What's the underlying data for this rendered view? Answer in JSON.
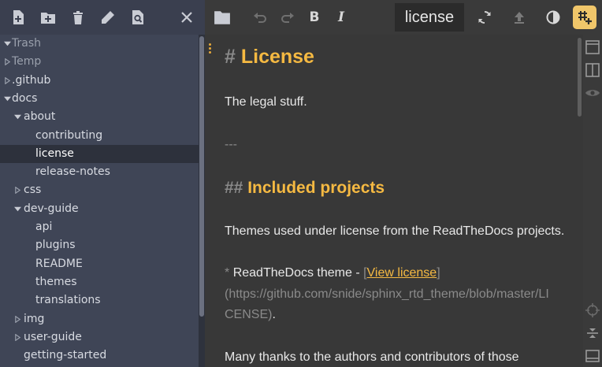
{
  "sidebar": {
    "toolbar": [
      {
        "icon": "new-file-icon"
      },
      {
        "icon": "new-folder-icon"
      },
      {
        "icon": "trash-icon"
      },
      {
        "icon": "pencil-icon"
      },
      {
        "icon": "search-file-icon"
      },
      {
        "icon": "close-icon"
      }
    ],
    "tree": [
      {
        "label": "Trash",
        "depth": 0,
        "caret": "open",
        "dim": true
      },
      {
        "label": "Temp",
        "depth": 0,
        "caret": "closed",
        "dim": true
      },
      {
        "label": ".github",
        "depth": 0,
        "caret": "closed"
      },
      {
        "label": "docs",
        "depth": 0,
        "caret": "open"
      },
      {
        "label": "about",
        "depth": 1,
        "caret": "open"
      },
      {
        "label": "contributing",
        "depth": 2,
        "caret": "none"
      },
      {
        "label": "license",
        "depth": 2,
        "caret": "none",
        "selected": true
      },
      {
        "label": "release-notes",
        "depth": 2,
        "caret": "none"
      },
      {
        "label": "css",
        "depth": 1,
        "caret": "closed"
      },
      {
        "label": "dev-guide",
        "depth": 1,
        "caret": "open"
      },
      {
        "label": "api",
        "depth": 2,
        "caret": "none"
      },
      {
        "label": "plugins",
        "depth": 2,
        "caret": "none"
      },
      {
        "label": "README",
        "depth": 2,
        "caret": "none"
      },
      {
        "label": "themes",
        "depth": 2,
        "caret": "none"
      },
      {
        "label": "translations",
        "depth": 2,
        "caret": "none"
      },
      {
        "label": "img",
        "depth": 1,
        "caret": "closed"
      },
      {
        "label": "user-guide",
        "depth": 1,
        "caret": "closed"
      },
      {
        "label": "getting-started",
        "depth": 1,
        "caret": "none"
      }
    ]
  },
  "editor_toolbar": {
    "title": "license",
    "bold_label": "B",
    "italic_label": "I"
  },
  "document": {
    "h1_marker": "#",
    "h1_text": "License",
    "intro": "The legal stuff.",
    "hr": "---",
    "h2_marker": "##",
    "h2_text": "Included projects",
    "para1": "Themes used under license from the ReadTheDocs projects.",
    "bullet_marker": "*",
    "bullet_text": "ReadTheDocs theme - ",
    "link_open": "[",
    "link_text": "View license",
    "link_close": "]",
    "url_line1": "(https://github.com/snide/sphinx_rtd_theme/blob/master/LI",
    "url_line2": "CENSE)",
    "url_end": ".",
    "para2": "Many thanks to the authors and contributors of those"
  },
  "colors": {
    "accent": "#f5b942",
    "sidebar_bg": "#3f4556",
    "editor_bg": "#383838",
    "selected_row": "#2d313c"
  }
}
